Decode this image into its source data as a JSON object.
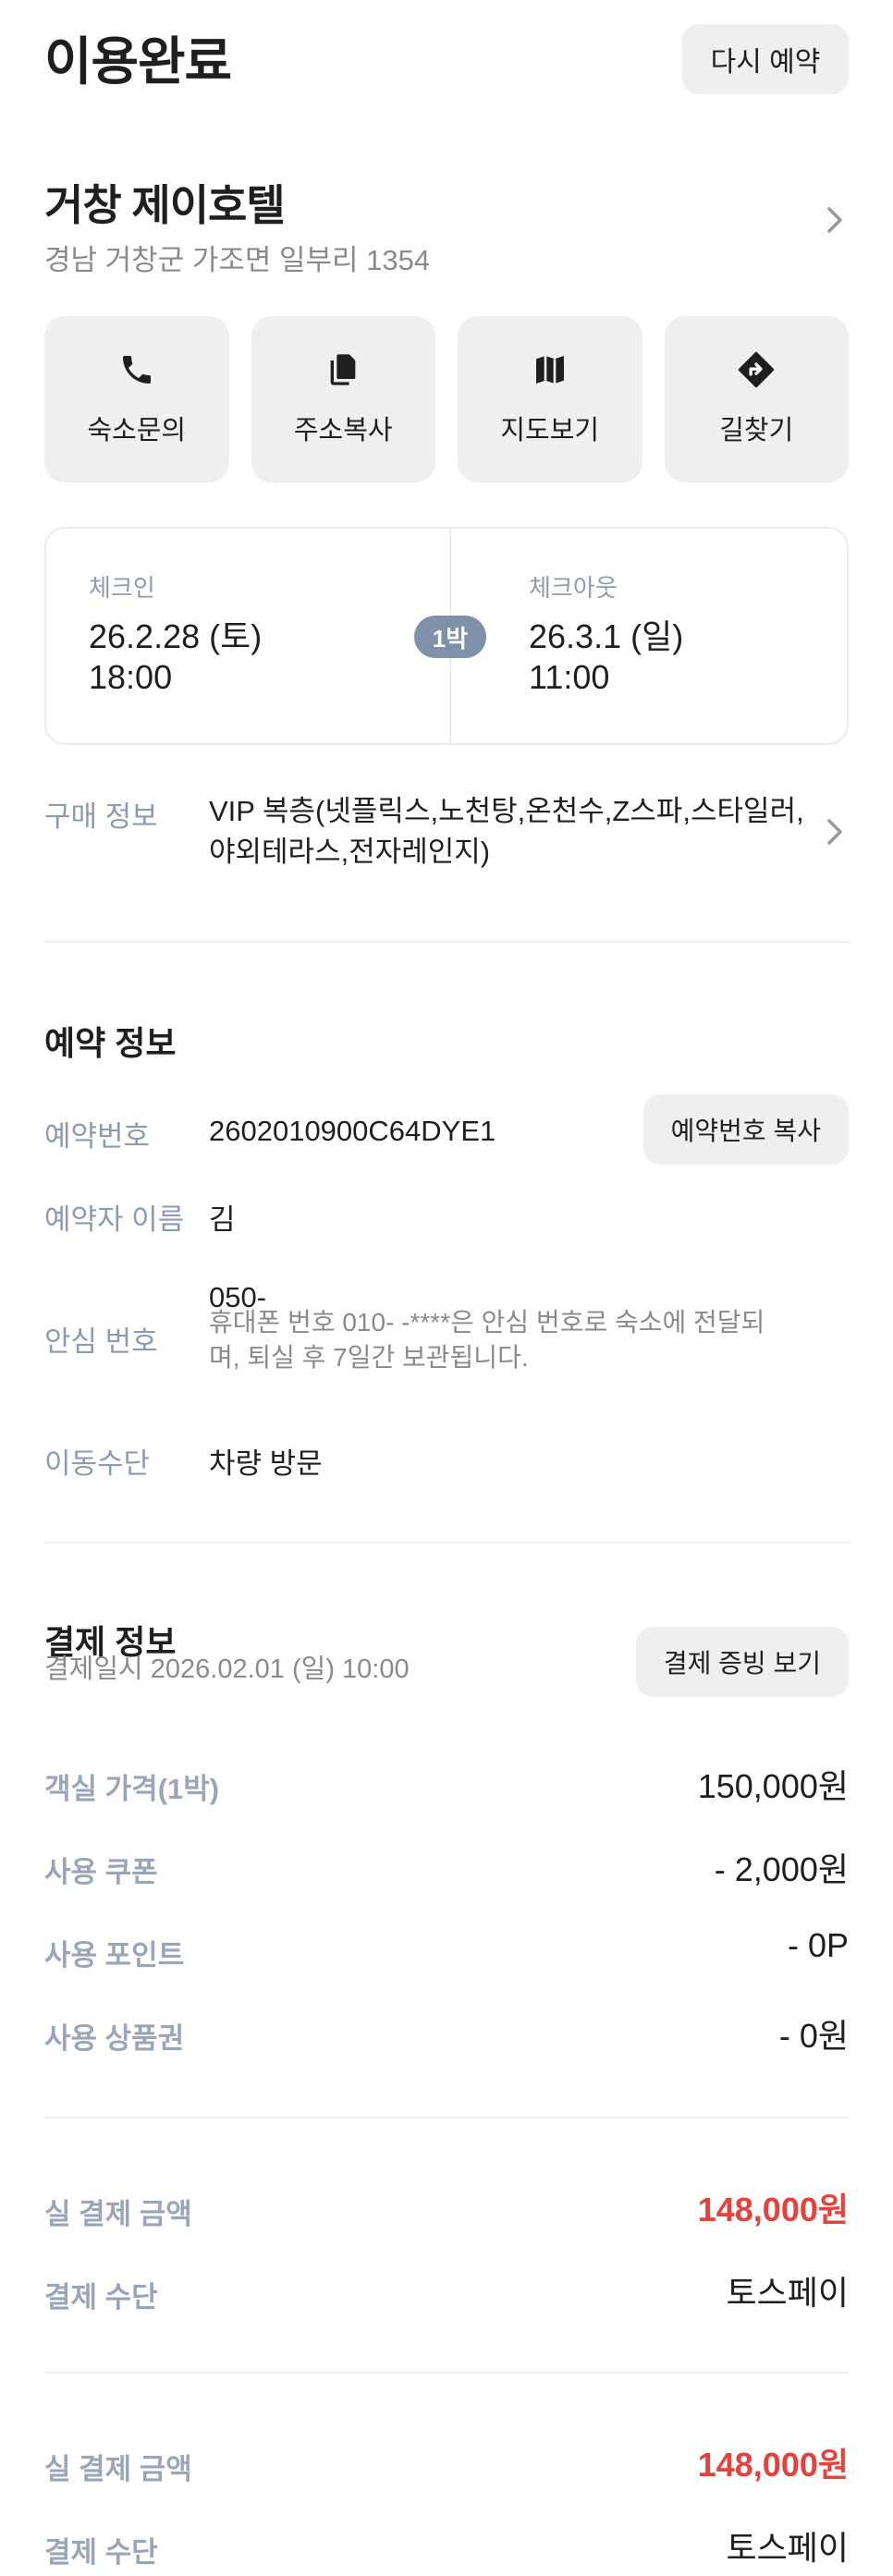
{
  "header": {
    "status": "이용완료",
    "rebook_label": "다시 예약"
  },
  "hotel": {
    "name": "거창 제이호텔",
    "address": "경남 거창군 가조면 일부리 1354"
  },
  "actions": [
    {
      "label": "숙소문의",
      "icon": "phone-icon"
    },
    {
      "label": "주소복사",
      "icon": "copy-icon"
    },
    {
      "label": "지도보기",
      "icon": "map-icon"
    },
    {
      "label": "길찾기",
      "icon": "directions-icon"
    }
  ],
  "stay": {
    "checkin_label": "체크인",
    "checkin_date": "26.2.28 (토)",
    "checkin_time": "18:00",
    "nights": "1박",
    "checkout_label": "체크아웃",
    "checkout_date": "26.3.1 (일)",
    "checkout_time": "11:00"
  },
  "purchase": {
    "label": "구매 정보",
    "value_line1": "VIP 복층(넷플릭스,노천탕,온천수,Z스파,스타일러,",
    "value_line2": "야외테라스,전자레인지)"
  },
  "reservation": {
    "title": "예약 정보",
    "number_label": "예약번호",
    "number_value": "2602010900C64DYE1",
    "copy_button": "예약번호 복사",
    "name_label": "예약자 이름",
    "name_value": "김",
    "safe_label": "안심 번호",
    "safe_value": "050-",
    "safe_note_line1": "휴대폰 번호 010-        -****은 안심 번호로 숙소에 전달되",
    "safe_note_line2": "며, 퇴실 후 7일간 보관됩니다.",
    "transport_label": "이동수단",
    "transport_value": "차량 방문"
  },
  "payment": {
    "title": "결제 정보",
    "paid_at": "결제일시 2026.02.01 (일) 10:00",
    "receipt_button": "결제 증빙 보기",
    "room_price_label": "객실 가격(1박)",
    "room_price_value": "150,000원",
    "coupon_label": "사용 쿠폰",
    "coupon_value": "- 2,000원",
    "point_label": "사용 포인트",
    "point_value": "- 0P",
    "voucher_label": "사용 상품권",
    "voucher_value": "- 0원",
    "total_label": "실 결제 금액",
    "total_value": "148,000원",
    "method_label": "결제 수단",
    "method_value": "토스페이",
    "total_label_2": "실 결제 금액",
    "total_value_2": "148,000원",
    "method_label_2": "결제 수단",
    "method_value_2": "토스페이"
  },
  "colors": {
    "accent_red": "#e5423e",
    "label_gray": "#8e9aae",
    "badge": "#7f91a8"
  }
}
